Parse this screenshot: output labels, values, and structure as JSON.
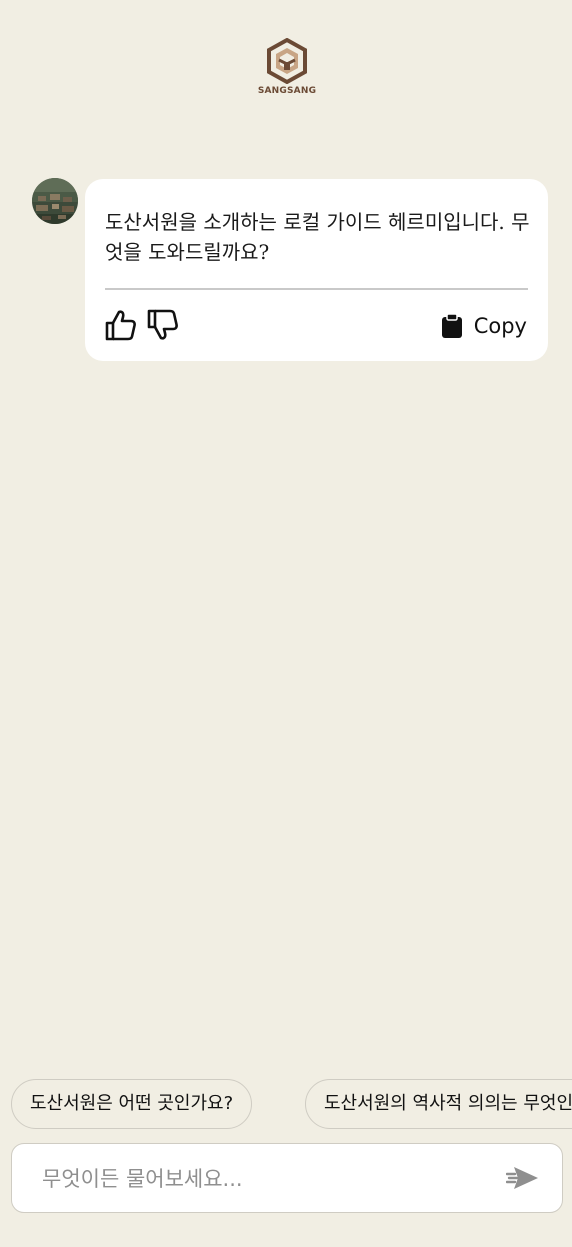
{
  "brand": {
    "logo_text": "SANGSANG"
  },
  "chat": {
    "assistant_message": "도산서원을 소개하는 로컬 가이드 헤르미입니다. 무엇을 도와드릴까요?",
    "copy_label": "Copy"
  },
  "suggestions": [
    {
      "label": "도산서원은 어떤 곳인가요?"
    },
    {
      "label": "도산서원의 역사적 의의는 무엇인가요?"
    }
  ],
  "composer": {
    "placeholder": "무엇이든 물어보세요...",
    "value": ""
  },
  "icons": {
    "like": "thumbs-up-icon",
    "dislike": "thumbs-down-icon",
    "copy": "clipboard-icon",
    "send": "send-icon"
  },
  "colors": {
    "background": "#f1eee3",
    "bubble": "#ffffff",
    "brand_brown": "#6b4a35"
  }
}
